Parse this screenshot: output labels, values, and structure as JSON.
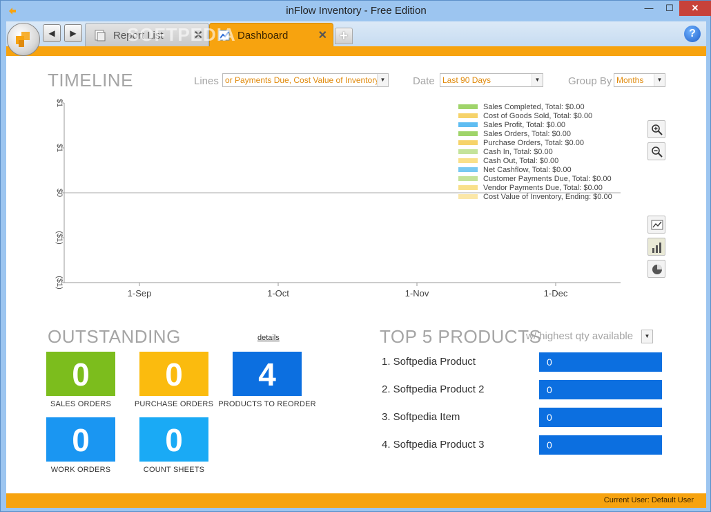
{
  "window": {
    "title": "inFlow Inventory - Free Edition",
    "min_glyph": "—",
    "max_glyph": "☐",
    "close_glyph": "✕"
  },
  "tabs": {
    "back_glyph": "◀",
    "forward_glyph": "▶",
    "items": [
      {
        "label": "Report List",
        "active": false,
        "close": "✕"
      },
      {
        "label": "Dashboard",
        "active": true,
        "close": "✕"
      }
    ],
    "new_tab_glyph": "+",
    "help_glyph": "?",
    "watermark": "SOFTPEDIA"
  },
  "timeline": {
    "title": "TIMELINE",
    "lines_label": "Lines",
    "lines_value": "or Payments Due, Cost Value of Inventory",
    "date_label": "Date",
    "date_value": "Last 90 Days",
    "group_label": "Group By",
    "group_value": "Months",
    "dropdown_glyph": "▼"
  },
  "chart_data": {
    "type": "line",
    "x": [
      "1-Sep",
      "1-Oct",
      "1-Nov",
      "1-Dec"
    ],
    "y_tick_labels": [
      "$1",
      "$1",
      "$0",
      "($1)",
      "($1)"
    ],
    "series": [
      {
        "name": "Sales Completed, Total: $0.00",
        "color": "#9fd46a",
        "values": [
          0,
          0,
          0,
          0
        ]
      },
      {
        "name": "Cost of Goods Sold, Total: $0.00",
        "color": "#f6d36a",
        "values": [
          0,
          0,
          0,
          0
        ]
      },
      {
        "name": "Sales Profit, Total: $0.00",
        "color": "#5fbdf2",
        "values": [
          0,
          0,
          0,
          0
        ]
      },
      {
        "name": "Sales Orders, Total: $0.00",
        "color": "#9fd46a",
        "values": [
          0,
          0,
          0,
          0
        ]
      },
      {
        "name": "Purchase Orders, Total: $0.00",
        "color": "#f6d36a",
        "values": [
          0,
          0,
          0,
          0
        ]
      },
      {
        "name": "Cash In, Total: $0.00",
        "color": "#c4e39a",
        "values": [
          0,
          0,
          0,
          0
        ]
      },
      {
        "name": "Cash Out, Total: $0.00",
        "color": "#f9e08a",
        "values": [
          0,
          0,
          0,
          0
        ]
      },
      {
        "name": "Net Cashflow, Total: $0.00",
        "color": "#78c9f2",
        "values": [
          0,
          0,
          0,
          0
        ]
      },
      {
        "name": "Customer Payments Due, Total: $0.00",
        "color": "#c4e39a",
        "values": [
          0,
          0,
          0,
          0
        ]
      },
      {
        "name": "Vendor Payments Due, Total: $0.00",
        "color": "#f9e08a",
        "values": [
          0,
          0,
          0,
          0
        ]
      },
      {
        "name": "Cost Value of Inventory, Ending: $0.00",
        "color": "#fbe7a8",
        "values": [
          0,
          0,
          0,
          0
        ]
      }
    ],
    "ylim": [
      -1,
      1
    ],
    "grid": false,
    "legend_position": "top-right"
  },
  "outstanding": {
    "title": "OUTSTANDING",
    "details_link": "details",
    "tiles": [
      {
        "value": "0",
        "label": "SALES ORDERS",
        "color": "#7cbd1d"
      },
      {
        "value": "0",
        "label": "PURCHASE ORDERS",
        "color": "#fbbb0e"
      },
      {
        "value": "4",
        "label": "PRODUCTS TO REORDER",
        "color": "#0c6fe0"
      },
      {
        "value": "0",
        "label": "WORK ORDERS",
        "color": "#1a96f2"
      },
      {
        "value": "0",
        "label": "COUNT SHEETS",
        "color": "#1aaaf5"
      }
    ]
  },
  "top5": {
    "title": "TOP 5 PRODUCTS",
    "subtitle": "w/ highest qty available",
    "dropdown_glyph": "▼",
    "products": [
      {
        "name": "1. Softpedia Product",
        "qty": "0"
      },
      {
        "name": "2. Softpedia Product 2",
        "qty": "0"
      },
      {
        "name": "3. Softpedia Item",
        "qty": "0"
      },
      {
        "name": "4. Softpedia Product 3",
        "qty": "0"
      }
    ]
  },
  "status": {
    "text": "Current User:   Default User"
  }
}
